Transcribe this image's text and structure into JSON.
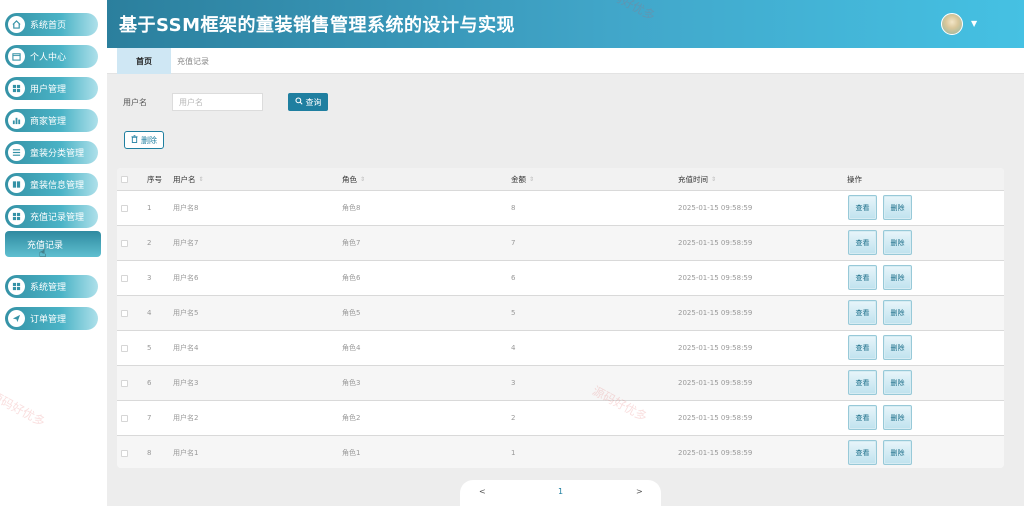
{
  "header": {
    "title": "基于SSM框架的童装销售管理系统的设计与实现"
  },
  "sidebar": {
    "items": [
      {
        "label": "系统首页",
        "icon": "home-icon"
      },
      {
        "label": "个人中心",
        "icon": "calendar-icon"
      },
      {
        "label": "用户管理",
        "icon": "grid-icon"
      },
      {
        "label": "商家管理",
        "icon": "bar-chart-icon"
      },
      {
        "label": "童装分类管理",
        "icon": "list-icon"
      },
      {
        "label": "童装信息管理",
        "icon": "book-icon"
      },
      {
        "label": "充值记录管理",
        "icon": "grid-icon"
      },
      {
        "label": "系统管理",
        "icon": "grid-icon"
      },
      {
        "label": "订单管理",
        "icon": "send-icon"
      }
    ],
    "submenu_active": "充值记录"
  },
  "tabs": [
    {
      "label": "首页"
    },
    {
      "label": "充值记录"
    }
  ],
  "search": {
    "label": "用户名",
    "placeholder": "用户名",
    "button_label": "查询"
  },
  "toolbar": {
    "delete_label": "删除"
  },
  "table": {
    "columns": [
      "序号",
      "用户名",
      "角色",
      "金额",
      "充值时间",
      "操作"
    ],
    "rows": [
      {
        "index": "1",
        "username": "用户名8",
        "role": "角色8",
        "amount": "8",
        "time": "2025-01-15 09:58:59"
      },
      {
        "index": "2",
        "username": "用户名7",
        "role": "角色7",
        "amount": "7",
        "time": "2025-01-15 09:58:59"
      },
      {
        "index": "3",
        "username": "用户名6",
        "role": "角色6",
        "amount": "6",
        "time": "2025-01-15 09:58:59"
      },
      {
        "index": "4",
        "username": "用户名5",
        "role": "角色5",
        "amount": "5",
        "time": "2025-01-15 09:58:59"
      },
      {
        "index": "5",
        "username": "用户名4",
        "role": "角色4",
        "amount": "4",
        "time": "2025-01-15 09:58:59"
      },
      {
        "index": "6",
        "username": "用户名3",
        "role": "角色3",
        "amount": "3",
        "time": "2025-01-15 09:58:59"
      },
      {
        "index": "7",
        "username": "用户名2",
        "role": "角色2",
        "amount": "2",
        "time": "2025-01-15 09:58:59"
      },
      {
        "index": "8",
        "username": "用户名1",
        "role": "角色1",
        "amount": "1",
        "time": "2025-01-15 09:58:59"
      }
    ],
    "view_label": "查看",
    "delete_label": "删除"
  },
  "pagination": {
    "prev": "<",
    "current": "1",
    "next": ">"
  },
  "watermark": "源码好优多",
  "colors": {
    "primary": "#1f7fa0",
    "header_start": "#2b7f9d",
    "header_end": "#45c1e3",
    "tab_active": "#cfe7f4"
  }
}
